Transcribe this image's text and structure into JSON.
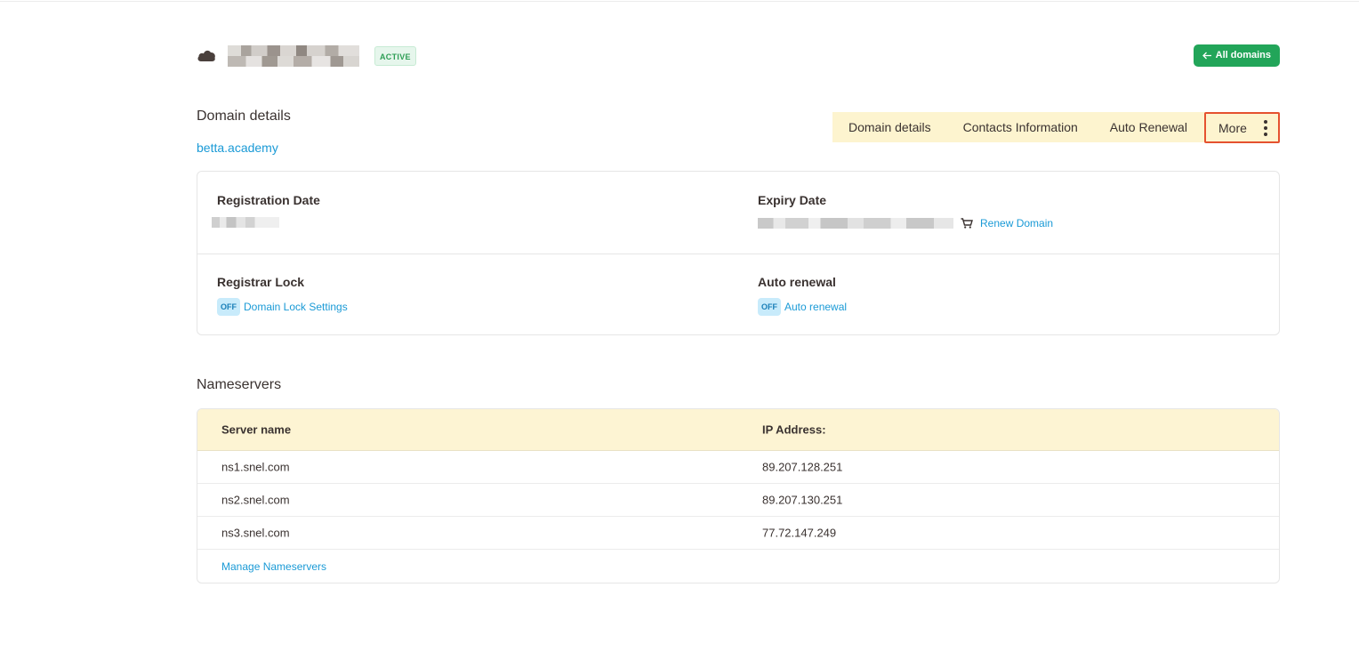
{
  "header": {
    "status_badge": "ACTIVE",
    "all_domains_label": "All domains",
    "colors": {
      "accent_green": "#22a559",
      "link_blue": "#1a9ad6",
      "highlight_red": "#e5512f",
      "tab_bg": "#fdf4cf"
    }
  },
  "details": {
    "title": "Domain details",
    "domain": "betta.academy"
  },
  "tabs": [
    {
      "label": "Domain details"
    },
    {
      "label": "Contacts Information"
    },
    {
      "label": "Auto Renewal"
    },
    {
      "label": "More"
    }
  ],
  "card": {
    "registration_date_label": "Registration Date",
    "expiry_date_label": "Expiry Date",
    "renew_domain_label": "Renew Domain",
    "registrar_lock_label": "Registrar Lock",
    "lock_status": "OFF",
    "lock_settings_label": "Domain Lock Settings",
    "auto_renewal_label": "Auto renewal",
    "auto_renewal_status": "OFF",
    "auto_renewal_link": "Auto renewal"
  },
  "nameservers": {
    "title": "Nameservers",
    "headers": [
      "Server name",
      "IP Address:"
    ],
    "rows": [
      {
        "name": "ns1.snel.com",
        "ip": "89.207.128.251"
      },
      {
        "name": "ns2.snel.com",
        "ip": "89.207.130.251"
      },
      {
        "name": "ns3.snel.com",
        "ip": "77.72.147.249"
      }
    ],
    "manage_label": "Manage Nameservers"
  }
}
